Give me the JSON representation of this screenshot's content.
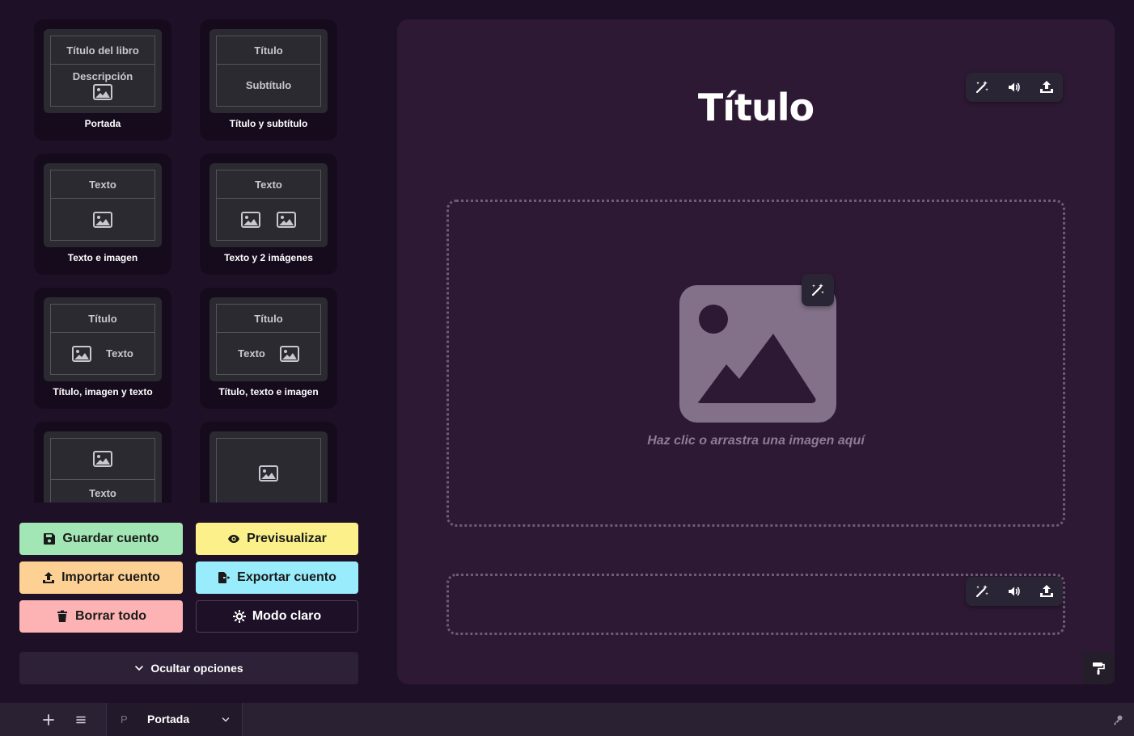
{
  "templates": [
    {
      "preview": {
        "lines": [
          "Título del libro",
          "Descripción"
        ]
      },
      "label": "Portada"
    },
    {
      "preview": {
        "lines": [
          "Título",
          "Subtítulo"
        ]
      },
      "label": "Título y subtítulo"
    },
    {
      "preview": {
        "lines": [
          "Texto"
        ]
      },
      "label": "Texto e imagen"
    },
    {
      "preview": {
        "lines": [
          "Texto"
        ]
      },
      "label": "Texto y 2 imágenes"
    },
    {
      "preview": {
        "lines": [
          "Título",
          "Texto"
        ]
      },
      "label": "Título, imagen y texto"
    },
    {
      "preview": {
        "lines": [
          "Título",
          "Texto"
        ]
      },
      "label": "Título, texto e imagen"
    },
    {
      "preview": {
        "lines": [
          "Texto"
        ]
      },
      "label": ""
    },
    {
      "preview": {
        "lines": []
      },
      "label": ""
    }
  ],
  "actions": {
    "save": {
      "label": "Guardar cuento",
      "color": "#a3e6b6",
      "icon": "floppy-disk-icon"
    },
    "preview": {
      "label": "Previsualizar",
      "color": "#fbf08a",
      "icon": "eye-icon"
    },
    "import": {
      "label": "Importar cuento",
      "color": "#fdd193",
      "icon": "upload-icon"
    },
    "export": {
      "label": "Exportar cuento",
      "color": "#99ecfb",
      "icon": "file-export-icon"
    },
    "clear": {
      "label": "Borrar todo",
      "color": "#fdb3b3",
      "icon": "trash-icon"
    },
    "theme": {
      "label": "Modo claro",
      "icon": "sun-icon"
    }
  },
  "toggle_options": {
    "label": "Ocultar opciones",
    "icon": "chevron-down-icon"
  },
  "canvas": {
    "title": "Título",
    "image_hint": "Haz clic o arrastra una imagen aquí",
    "toolbar_icons": [
      "magic-wand-icon",
      "speaker-icon",
      "upload-icon"
    ]
  },
  "bottom_bar": {
    "page_prefix": "P",
    "page_name": "Portada",
    "icons": [
      "plus-icon",
      "menu-icon",
      "chevron-down-icon",
      "key-icon"
    ]
  }
}
